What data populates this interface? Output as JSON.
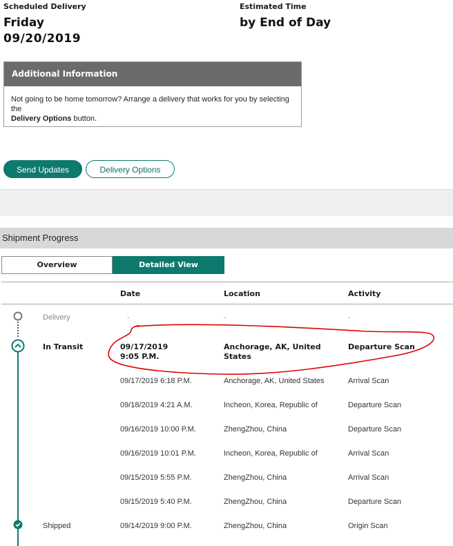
{
  "delivery": {
    "scheduled_label": "Scheduled Delivery",
    "day": "Friday",
    "date": "09/20/2019",
    "estimated_label": "Estimated Time",
    "estimated_value": "by End of Day"
  },
  "additional_info": {
    "title": "Additional Information",
    "text_before": "Not going to be home tomorrow? Arrange a delivery that works for you by selecting the",
    "text_bold": "Delivery Options",
    "text_after": "button."
  },
  "buttons": {
    "send_updates": "Send Updates",
    "delivery_options": "Delivery Options"
  },
  "progress": {
    "title": "Shipment Progress",
    "tabs": {
      "overview": "Overview",
      "detailed": "Detailed View"
    },
    "columns": {
      "date": "Date",
      "location": "Location",
      "activity": "Activity"
    },
    "delivery_row": {
      "status": "Delivery",
      "date": "-",
      "location": "-",
      "activity": "-"
    },
    "in_transit_row": {
      "status": "In Transit",
      "date": "09/17/2019",
      "time": "9:05 P.M.",
      "location_line1": "Anchorage, AK, United",
      "location_line2": "States",
      "activity": "Departure Scan"
    },
    "rows": [
      {
        "date": "09/17/2019   6:18 P.M.",
        "location": "Anchorage, AK, United States",
        "activity": "Arrival Scan"
      },
      {
        "date": "09/18/2019   4:21 A.M.",
        "location": "Incheon, Korea, Republic of",
        "activity": "Departure Scan"
      },
      {
        "date": "09/16/2019   10:00 P.M.",
        "location": "ZhengZhou, China",
        "activity": "Departure Scan"
      },
      {
        "date": "09/16/2019   10:01 P.M.",
        "location": "Incheon, Korea, Republic of",
        "activity": "Arrival Scan"
      },
      {
        "date": "09/15/2019   5:55 P.M.",
        "location": "ZhengZhou, China",
        "activity": "Arrival Scan"
      },
      {
        "date": "09/15/2019   5:40 P.M.",
        "location": "ZhengZhou, China",
        "activity": "Departure Scan"
      }
    ],
    "shipped_row": {
      "status": "Shipped",
      "date": "09/14/2019   9:00 P.M.",
      "location": "ZhengZhou, China",
      "activity": "Origin Scan"
    }
  },
  "colors": {
    "brand_teal": "#0c7a6d",
    "annotation_red": "#e00000",
    "header_gray": "#6b6b6b"
  }
}
